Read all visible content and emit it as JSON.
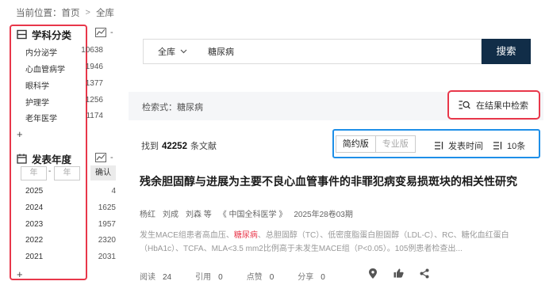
{
  "breadcrumb": {
    "label": "当前位置：",
    "items": [
      "首页",
      "全库"
    ]
  },
  "sidebar": {
    "subjects": {
      "title": "学科分类",
      "items": [
        {
          "label": "内分泌学",
          "count": "10638"
        },
        {
          "label": "心血管病学",
          "count": "1946"
        },
        {
          "label": "眼科学",
          "count": "1377"
        },
        {
          "label": "护理学",
          "count": "1256"
        },
        {
          "label": "老年医学",
          "count": "1174"
        }
      ],
      "more": "+"
    },
    "years": {
      "title": "发表年度",
      "from_placeholder": "年",
      "range_sep": "-",
      "to_placeholder": "年",
      "confirm": "确认",
      "items": [
        {
          "label": "2025",
          "count": "4"
        },
        {
          "label": "2024",
          "count": "1625"
        },
        {
          "label": "2023",
          "count": "1957"
        },
        {
          "label": "2022",
          "count": "2320"
        },
        {
          "label": "2021",
          "count": "2031"
        }
      ],
      "more": "+"
    },
    "chart_toggle": "-"
  },
  "search": {
    "scope": "全库",
    "query": "糖尿病",
    "button": "搜索"
  },
  "expression": {
    "text": "检索式：糖尿病",
    "in_result": "在结果中检索"
  },
  "results": {
    "found_prefix": "找到",
    "count": "42252",
    "found_suffix": "条文献",
    "version_brief": "简约版",
    "version_pro": "专业版",
    "sort_time": "发表时间",
    "page_size": "10条"
  },
  "article": {
    "title": "残余胆固醇与进展为主要不良心血管事件的非罪犯病变易损斑块的相关性研究",
    "authors": [
      "杨红",
      "刘成",
      "刘森 等"
    ],
    "journal": "《 中国全科医学 》",
    "issue": "2025年28卷03期",
    "abstract_before": "发生MACE组患者高血压、",
    "abstract_highlight": "糖尿病",
    "abstract_after": "、总胆固醇（TC）、低密度脂蛋白胆固醇（LDL-C）、RC、糖化血红蛋白（HbA1c）、TCFA、MLA<3.5 mm2比例高于未发生MACE组（P<0.05）。105例患者检查出...",
    "stats": [
      {
        "label": "阅读",
        "value": "24"
      },
      {
        "label": "引用",
        "value": "0"
      },
      {
        "label": "点赞",
        "value": "0"
      },
      {
        "label": "分享",
        "value": "0"
      }
    ]
  },
  "colors": {
    "highlight_red": "#e8374a",
    "highlight_blue": "#1e8fe8",
    "search_button": "#112d48"
  }
}
